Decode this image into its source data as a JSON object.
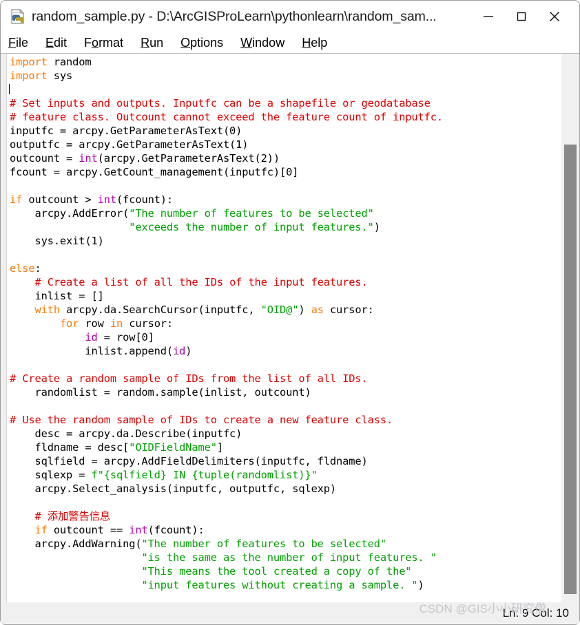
{
  "window": {
    "title": "random_sample.py - D:\\ArcGISProLearn\\pythonlearn\\random_sam...",
    "icon": "python-file-icon",
    "controls": {
      "minimize_label": "—",
      "maximize_label": "☐",
      "close_label": "✕"
    }
  },
  "menubar": {
    "items": [
      {
        "label": "File",
        "mnemonic": "F",
        "rest": "ile"
      },
      {
        "label": "Edit",
        "mnemonic": "E",
        "rest": "dit"
      },
      {
        "label": "Format",
        "pre": "F",
        "mnemonic": "o",
        "rest": "rmat"
      },
      {
        "label": "Run",
        "mnemonic": "R",
        "rest": "un"
      },
      {
        "label": "Options",
        "mnemonic": "O",
        "rest": "ptions"
      },
      {
        "label": "Window",
        "mnemonic": "W",
        "rest": "indow"
      },
      {
        "label": "Help",
        "mnemonic": "H",
        "rest": "elp"
      }
    ]
  },
  "editor": {
    "language": "python",
    "filename": "random_sample.py",
    "cursor_line": 2,
    "cursor_col": 10,
    "code_lines": [
      "import random",
      "import sys",
      "",
      "# Set inputs and outputs. Inputfc can be a shapefile or geodatabase",
      "# feature class. Outcount cannot exceed the feature count of inputfc.",
      "inputfc = arcpy.GetParameterAsText(0)",
      "outputfc = arcpy.GetParameterAsText(1)",
      "outcount = int(arcpy.GetParameterAsText(2))",
      "fcount = arcpy.GetCount_management(inputfc)[0]",
      "",
      "if outcount > int(fcount):",
      "    arcpy.AddError(\"The number of features to be selected\"",
      "                   \"exceeds the number of input features.\")",
      "    sys.exit(1)",
      "",
      "else:",
      "    # Create a list of all the IDs of the input features.",
      "    inlist = []",
      "    with arcpy.da.SearchCursor(inputfc, \"OID@\") as cursor:",
      "        for row in cursor:",
      "            id = row[0]",
      "            inlist.append(id)",
      "",
      "# Create a random sample of IDs from the list of all IDs.",
      "    randomlist = random.sample(inlist, outcount)",
      "",
      "# Use the random sample of IDs to create a new feature class.",
      "    desc = arcpy.da.Describe(inputfc)",
      "    fldname = desc[\"OIDFieldName\"]",
      "    sqlfield = arcpy.AddFieldDelimiters(inputfc, fldname)",
      "    sqlexp = f\"{sqlfield} IN {tuple(randomlist)}\"",
      "    arcpy.Select_analysis(inputfc, outputfc, sqlexp)",
      "",
      "    # 添加警告信息",
      "    if outcount == int(fcount):",
      "    arcpy.AddWarning(\"The number of features to be selected\"",
      "                     \"is the same as the number of input features. \"",
      "                     \"This means the tool created a copy of the\"",
      "                     \"input features without creating a sample. \")"
    ],
    "colors": {
      "keyword": "#ff7700",
      "builtin": "#b000b0",
      "string": "#00a000",
      "comment": "#dd0000",
      "text": "#000000",
      "background": "#ffffff"
    }
  },
  "statusbar": {
    "position_text": "Ln: 9  Col: 10",
    "line": "9",
    "column": "10"
  },
  "watermark": {
    "text": "CSDN @GIS小小研究僧"
  }
}
